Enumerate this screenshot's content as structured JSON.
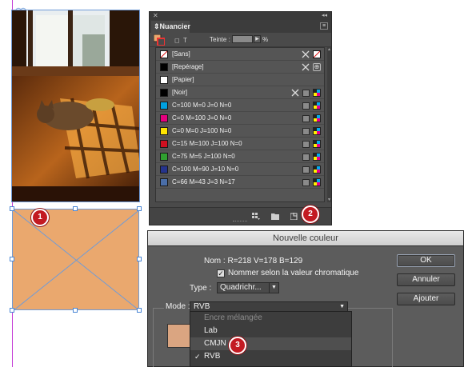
{
  "canvas": {
    "photo_alt": "cat lying in sunlight by a window",
    "placeholder_color": "#eaa86e"
  },
  "callouts": [
    "1",
    "2",
    "3"
  ],
  "swatches_panel": {
    "tab_title": "Nuancier",
    "tint_label": "Teinte :",
    "tint_unit": "%",
    "swatches": [
      {
        "name": "[Sans]",
        "color": "none",
        "icons": [
          "no-edit",
          "none"
        ]
      },
      {
        "name": "[Repérage]",
        "color": "#000000",
        "icons": [
          "no-edit",
          "registration"
        ]
      },
      {
        "name": "[Papier]",
        "color": "#ffffff",
        "icons": []
      },
      {
        "name": "[Noir]",
        "color": "#000000",
        "icons": [
          "no-edit",
          "process",
          "cmyk"
        ]
      },
      {
        "name": "C=100 M=0 J=0 N=0",
        "color": "#00a0e0",
        "icons": [
          "process",
          "cmyk"
        ]
      },
      {
        "name": "C=0 M=100 J=0 N=0",
        "color": "#e5007e",
        "icons": [
          "process",
          "cmyk"
        ]
      },
      {
        "name": "C=0 M=0 J=100 N=0",
        "color": "#ffe500",
        "icons": [
          "process",
          "cmyk"
        ]
      },
      {
        "name": "C=15 M=100 J=100 N=0",
        "color": "#cf1020",
        "icons": [
          "process",
          "cmyk"
        ]
      },
      {
        "name": "C=75 M=5 J=100 N=0",
        "color": "#30a030",
        "icons": [
          "process",
          "cmyk"
        ]
      },
      {
        "name": "C=100 M=90 J=10 N=0",
        "color": "#26348c",
        "icons": [
          "process",
          "cmyk"
        ]
      },
      {
        "name": "C=66 M=43 J=3 N=17",
        "color": "#4a6ea8",
        "icons": [
          "process",
          "cmyk"
        ]
      }
    ]
  },
  "dialog": {
    "title": "Nouvelle couleur",
    "nom_label": "Nom :",
    "nom_value": "R=218 V=178 B=129",
    "checkbox_label": "Nommer selon la valeur chromatique",
    "checkbox_checked": true,
    "type_label": "Type :",
    "type_value": "Quadrichr...",
    "mode_label": "Mode :",
    "mode_value": "RVB",
    "preview_color": "#daa581",
    "buttons": {
      "ok": "OK",
      "cancel": "Annuler",
      "add": "Ajouter"
    }
  },
  "mode_dropdown": {
    "items": [
      {
        "label": "Encre mélangée",
        "disabled": true,
        "checked": false
      },
      {
        "label": "Lab",
        "disabled": false,
        "checked": false
      },
      {
        "label": "CMJN",
        "disabled": false,
        "checked": false
      },
      {
        "label": "RVB",
        "disabled": false,
        "checked": true
      }
    ]
  }
}
